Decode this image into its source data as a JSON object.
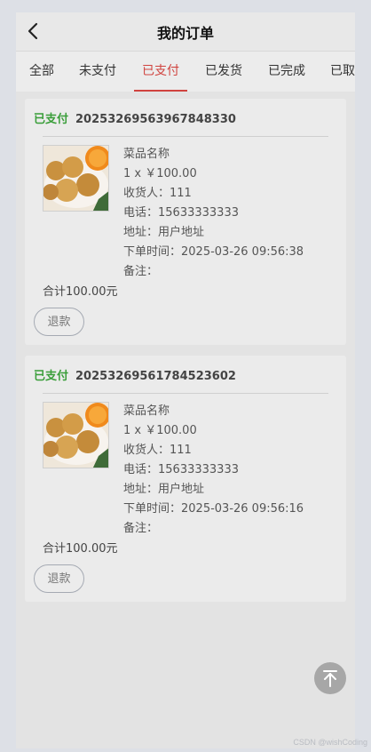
{
  "header": {
    "title": "我的订单"
  },
  "tabs": [
    {
      "label": "全部"
    },
    {
      "label": "未支付"
    },
    {
      "label": "已支付"
    },
    {
      "label": "已发货"
    },
    {
      "label": "已完成"
    },
    {
      "label": "已取"
    }
  ],
  "active_tab": "已支付",
  "orders": [
    {
      "status": "已支付",
      "order_no": "20253269563967848330",
      "dish_name": "菜品名称",
      "qty_price": "1 x ￥100.00",
      "receiver": "收货人：111",
      "phone": "电话：15633333333",
      "address": "地址：用户地址",
      "order_time": "下单时间：2025-03-26 09:56:38",
      "remark": "备注：",
      "total": "合计100.00元",
      "refund_label": "退款"
    },
    {
      "status": "已支付",
      "order_no": "20253269561784523602",
      "dish_name": "菜品名称",
      "qty_price": "1 x ￥100.00",
      "receiver": "收货人：111",
      "phone": "电话：15633333333",
      "address": "地址：用户地址",
      "order_time": "下单时间：2025-03-26 09:56:16",
      "remark": "备注：",
      "total": "合计100.00元",
      "refund_label": "退款"
    }
  ],
  "watermark": "CSDN @wishCoding",
  "colors": {
    "accent_red": "#d0433f",
    "status_green": "#3a9e3a",
    "button_border": "#a5aab3",
    "back_to_top": "#a7a7a7"
  },
  "icons": {
    "back": "chevron-left-icon",
    "back_to_top": "arrow-up-to-top-icon",
    "product": "food-thumbnail-image"
  }
}
